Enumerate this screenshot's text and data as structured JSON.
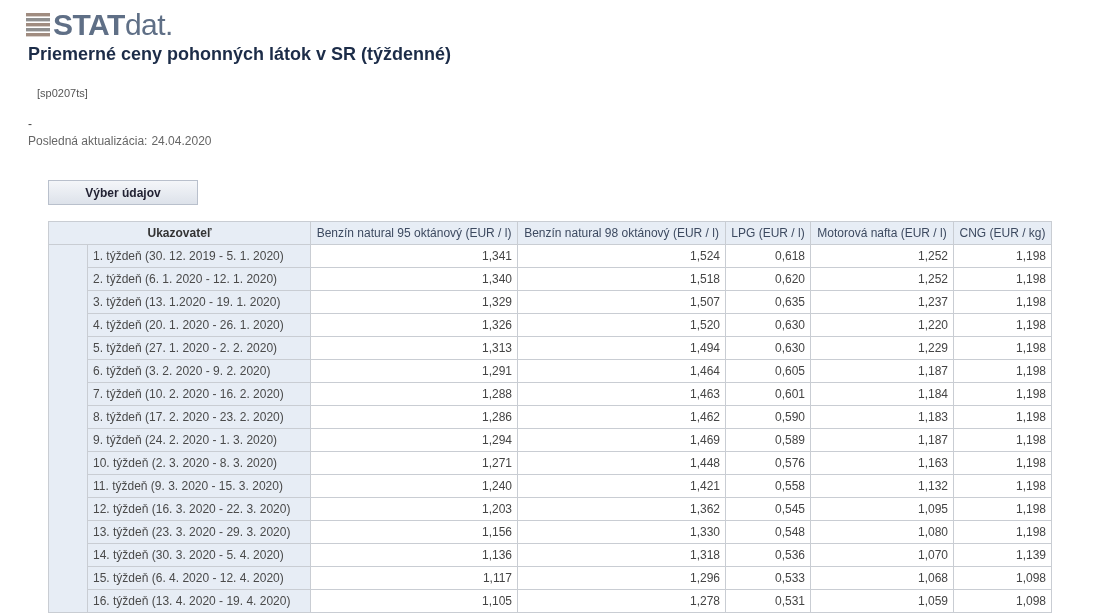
{
  "logo": {
    "text": "**STAT**dat."
  },
  "title": "Priemerné ceny pohonných látok v SR (týždenné)",
  "code": "[sp0207ts]",
  "note": "-",
  "updated": {
    "label": "Posledná aktualizácia:",
    "value": "24.04.2020"
  },
  "button": "Výber údajov",
  "table": {
    "columns": [
      "Ukazovateľ",
      "Benzín natural 95 oktánový (EUR / l)",
      "Benzín natural 98 oktánový (EUR / l)",
      "LPG (EUR / l)",
      "Motorová nafta (EUR / l)",
      "CNG (EUR / kg)"
    ],
    "rows": [
      {
        "label": "1. týždeň (30. 12. 2019 - 5. 1. 2020)",
        "values": [
          "1,341",
          "1,524",
          "0,618",
          "1,252",
          "1,198"
        ]
      },
      {
        "label": "2. týždeň (6. 1. 2020 - 12. 1. 2020)",
        "values": [
          "1,340",
          "1,518",
          "0,620",
          "1,252",
          "1,198"
        ]
      },
      {
        "label": "3. týždeň (13. 1.2020 - 19. 1. 2020)",
        "values": [
          "1,329",
          "1,507",
          "0,635",
          "1,237",
          "1,198"
        ]
      },
      {
        "label": "4. týždeň (20. 1. 2020 - 26. 1. 2020)",
        "values": [
          "1,326",
          "1,520",
          "0,630",
          "1,220",
          "1,198"
        ]
      },
      {
        "label": "5. týždeň (27. 1. 2020 - 2. 2. 2020)",
        "values": [
          "1,313",
          "1,494",
          "0,630",
          "1,229",
          "1,198"
        ]
      },
      {
        "label": "6. týždeň (3. 2. 2020 - 9. 2. 2020)",
        "values": [
          "1,291",
          "1,464",
          "0,605",
          "1,187",
          "1,198"
        ]
      },
      {
        "label": "7. týždeň (10. 2. 2020 - 16. 2. 2020)",
        "values": [
          "1,288",
          "1,463",
          "0,601",
          "1,184",
          "1,198"
        ]
      },
      {
        "label": "8. týždeň (17. 2. 2020 - 23. 2. 2020)",
        "values": [
          "1,286",
          "1,462",
          "0,590",
          "1,183",
          "1,198"
        ]
      },
      {
        "label": "9. týždeň (24. 2. 2020 - 1. 3. 2020)",
        "values": [
          "1,294",
          "1,469",
          "0,589",
          "1,187",
          "1,198"
        ]
      },
      {
        "label": "10. týždeň (2. 3. 2020 - 8. 3. 2020)",
        "values": [
          "1,271",
          "1,448",
          "0,576",
          "1,163",
          "1,198"
        ]
      },
      {
        "label": "11. týždeň (9. 3. 2020 - 15. 3. 2020)",
        "values": [
          "1,240",
          "1,421",
          "0,558",
          "1,132",
          "1,198"
        ]
      },
      {
        "label": "12. týždeň (16. 3. 2020 - 22. 3. 2020)",
        "values": [
          "1,203",
          "1,362",
          "0,545",
          "1,095",
          "1,198"
        ]
      },
      {
        "label": "13. týždeň (23. 3. 2020 - 29. 3. 2020)",
        "values": [
          "1,156",
          "1,330",
          "0,548",
          "1,080",
          "1,198"
        ]
      },
      {
        "label": "14. týždeň (30. 3. 2020 - 5. 4. 2020)",
        "values": [
          "1,136",
          "1,318",
          "0,536",
          "1,070",
          "1,139"
        ]
      },
      {
        "label": "15. týždeň (6. 4. 2020 - 12. 4. 2020)",
        "values": [
          "1,117",
          "1,296",
          "0,533",
          "1,068",
          "1,098"
        ]
      },
      {
        "label": "16. týždeň (13. 4. 2020 - 19. 4. 2020)",
        "values": [
          "1,105",
          "1,278",
          "0,531",
          "1,059",
          "1,098"
        ]
      }
    ]
  }
}
